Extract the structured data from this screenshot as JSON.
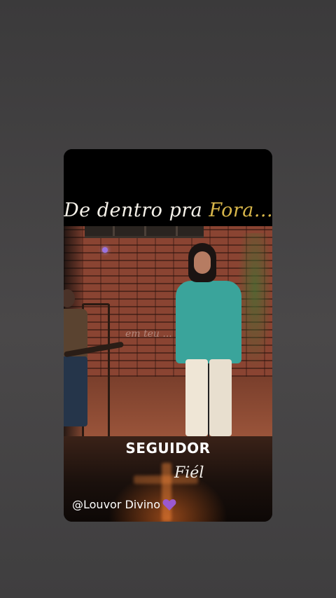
{
  "story": {
    "title_part1": "De dentro pra ",
    "title_part2": "Fora...",
    "overlay_lyric": "em teu ...",
    "caption_main": "SEGUIDOR",
    "caption_sub": "Fiél",
    "handle": "@Louvor Divino",
    "handle_emoji": "purple-heart-icon"
  },
  "colors": {
    "background": "#424142",
    "title_accent": "#d8b64a",
    "jacket": "#3aa49b",
    "heart": "#9b59d0"
  }
}
